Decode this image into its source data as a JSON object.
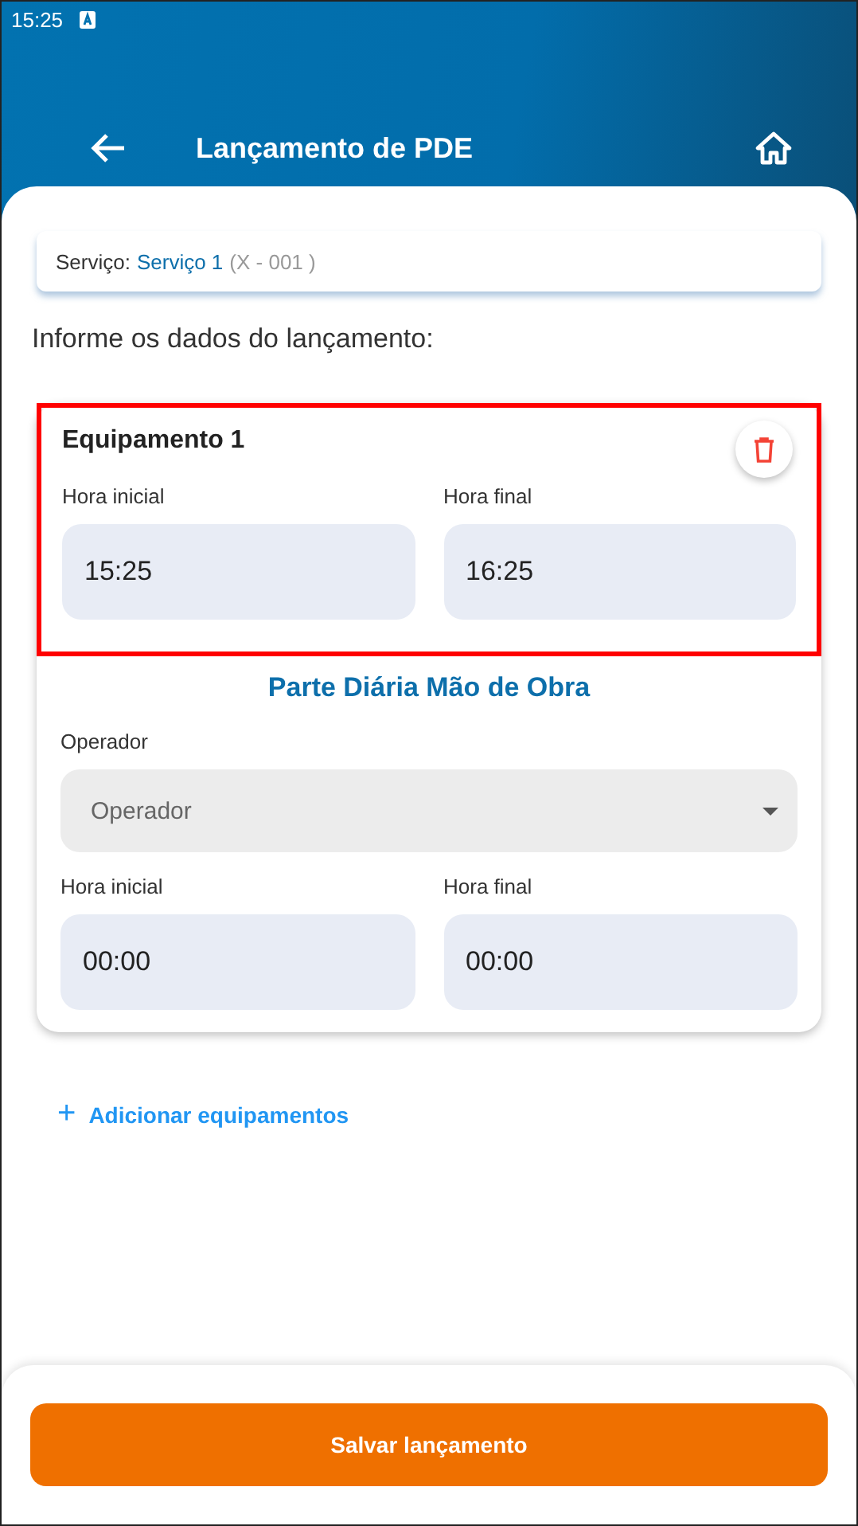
{
  "status_bar": {
    "time": "15:25"
  },
  "header": {
    "title": "Lançamento de PDE"
  },
  "service": {
    "label": "Serviço:",
    "name": "Serviço 1",
    "code": "(X - 001 )"
  },
  "instructions": "Informe os dados do lançamento:",
  "equipment": {
    "title": "Equipamento 1",
    "highlighted": true,
    "times": [
      {
        "label": "Hora inicial",
        "value": "15:25"
      },
      {
        "label": "Hora final",
        "value": "16:25"
      }
    ]
  },
  "labor": {
    "title": "Parte Diária Mão de Obra",
    "operator": {
      "label": "Operador",
      "placeholder": "Operador"
    },
    "times": [
      {
        "label": "Hora inicial",
        "value": "00:00"
      },
      {
        "label": "Hora final",
        "value": "00:00"
      }
    ]
  },
  "add_link": {
    "icon": "+",
    "label": "Adicionar equipamentos"
  },
  "save_button": "Salvar lançamento"
}
